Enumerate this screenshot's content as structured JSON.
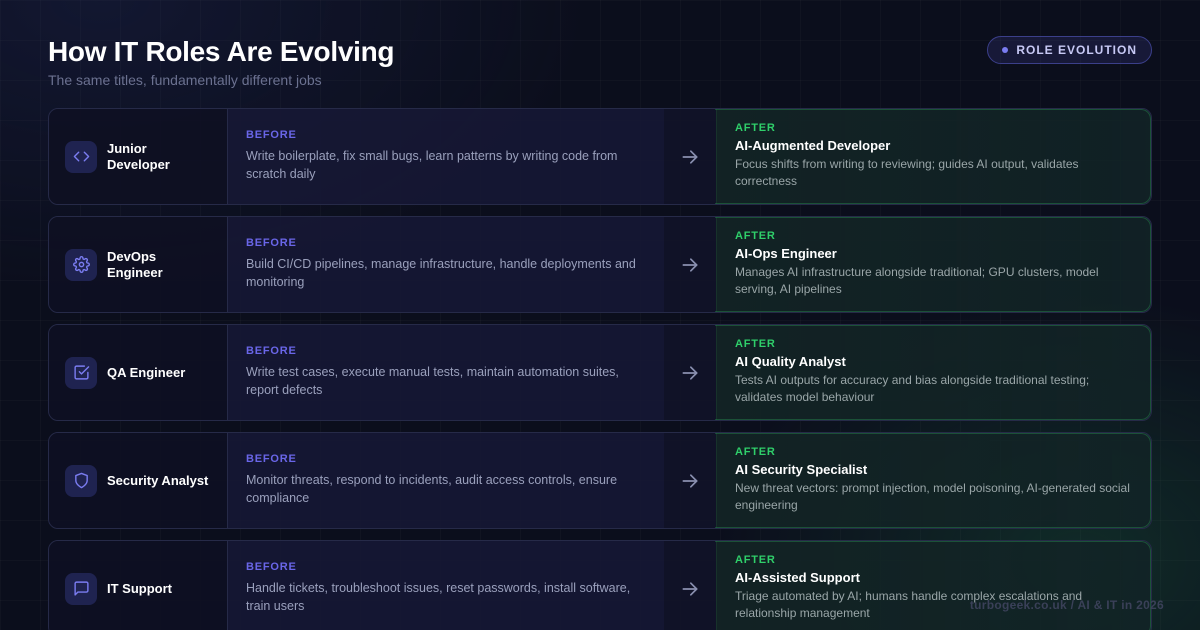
{
  "header": {
    "title": "How IT Roles Are Evolving",
    "subtitle": "The same titles, fundamentally different jobs",
    "badge": "ROLE EVOLUTION"
  },
  "colors": {
    "accent_before": "#6a66e8",
    "accent_after": "#2fcf6a",
    "icon": "#7a7cf0"
  },
  "labels": {
    "before": "BEFORE",
    "after": "AFTER"
  },
  "rows": [
    {
      "icon": "code-icon",
      "role": "Junior Developer",
      "before": "Write boilerplate, fix small bugs, learn patterns by writing code from scratch daily",
      "after_title": "AI-Augmented Developer",
      "after_text": "Focus shifts from writing to reviewing; guides AI output, validates correctness"
    },
    {
      "icon": "gear-icon",
      "role": "DevOps Engineer",
      "before": "Build CI/CD pipelines, manage infrastructure, handle deployments and monitoring",
      "after_title": "AI-Ops Engineer",
      "after_text": "Manages AI infrastructure alongside traditional; GPU clusters, model serving, AI pipelines"
    },
    {
      "icon": "checkbox-icon",
      "role": "QA Engineer",
      "before": "Write test cases, execute manual tests, maintain automation suites, report defects",
      "after_title": "AI Quality Analyst",
      "after_text": "Tests AI outputs for accuracy and bias alongside traditional testing; validates model behaviour"
    },
    {
      "icon": "shield-icon",
      "role": "Security Analyst",
      "before": "Monitor threats, respond to incidents, audit access controls, ensure compliance",
      "after_title": "AI Security Specialist",
      "after_text": "New threat vectors: prompt injection, model poisoning, AI-generated social engineering"
    },
    {
      "icon": "chat-icon",
      "role": "IT Support",
      "before": "Handle tickets, troubleshoot issues, reset passwords, install software, train users",
      "after_title": "AI-Assisted Support",
      "after_text": "Triage automated by AI; humans handle complex escalations and relationship management"
    }
  ],
  "footer": "turbogeek.co.uk / AI & IT in 2026"
}
